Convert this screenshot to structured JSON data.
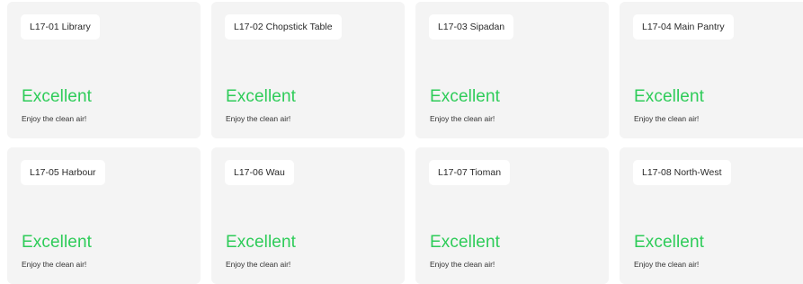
{
  "rooms": [
    {
      "name": "L17-01 Library",
      "status": "Excellent",
      "message": "Enjoy the clean air!"
    },
    {
      "name": "L17-02 Chopstick Table",
      "status": "Excellent",
      "message": "Enjoy the clean air!"
    },
    {
      "name": "L17-03 Sipadan",
      "status": "Excellent",
      "message": "Enjoy the clean air!"
    },
    {
      "name": "L17-04 Main Pantry",
      "status": "Excellent",
      "message": "Enjoy the clean air!"
    },
    {
      "name": "L17-05 Harbour",
      "status": "Excellent",
      "message": "Enjoy the clean air!"
    },
    {
      "name": "L17-06 Wau",
      "status": "Excellent",
      "message": "Enjoy the clean air!"
    },
    {
      "name": "L17-07 Tioman",
      "status": "Excellent",
      "message": "Enjoy the clean air!"
    },
    {
      "name": "L17-08 North-West",
      "status": "Excellent",
      "message": "Enjoy the clean air!"
    }
  ],
  "colors": {
    "status_excellent": "#2ecc59",
    "card_background": "#f4f4f4"
  }
}
